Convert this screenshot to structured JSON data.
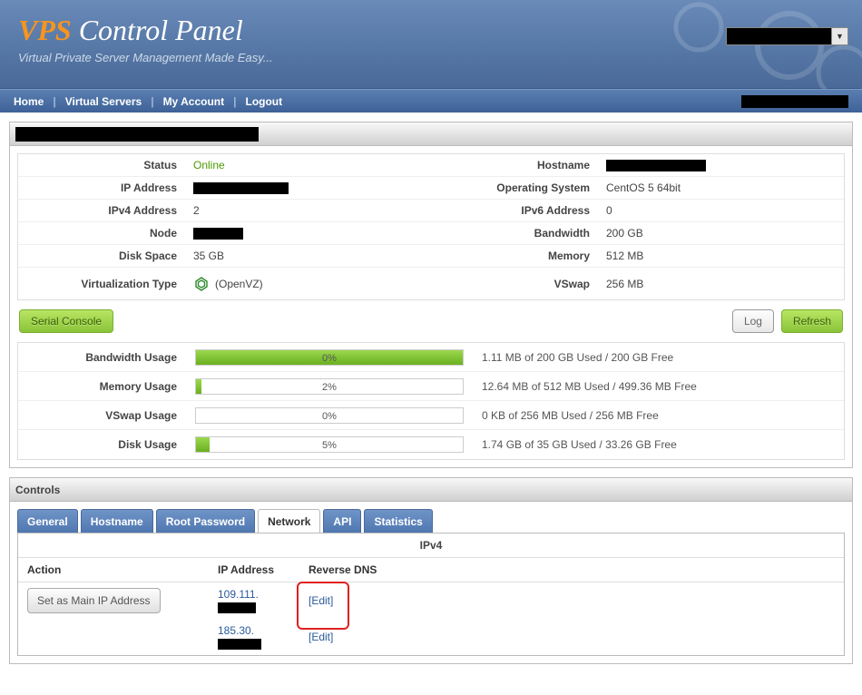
{
  "header": {
    "logo_prefix": "VPS",
    "logo_suffix": " Control Panel",
    "tagline": "Virtual Private Server Management Made Easy..."
  },
  "nav": {
    "home": "Home",
    "virtual_servers": "Virtual Servers",
    "my_account": "My Account",
    "logout": "Logout"
  },
  "info_left": {
    "status_label": "Status",
    "status_value": "Online",
    "ip_label": "IP Address",
    "ipv4_label": "IPv4 Address",
    "ipv4_value": "2",
    "node_label": "Node",
    "disk_label": "Disk Space",
    "disk_value": "35 GB",
    "virt_label": "Virtualization Type",
    "virt_value": "(OpenVZ)"
  },
  "info_right": {
    "hostname_label": "Hostname",
    "os_label": "Operating System",
    "os_value": "CentOS 5 64bit",
    "ipv6_label": "IPv6 Address",
    "ipv6_value": "0",
    "bw_label": "Bandwidth",
    "bw_value": "200 GB",
    "mem_label": "Memory",
    "mem_value": "512 MB",
    "vswap_label": "VSwap",
    "vswap_value": "256 MB"
  },
  "buttons": {
    "serial_console": "Serial Console",
    "log": "Log",
    "refresh": "Refresh"
  },
  "usage": {
    "bw_label": "Bandwidth Usage",
    "bw_pct": "0%",
    "bw_width": "0%",
    "bw_text": "1.11 MB of 200 GB Used / 200 GB Free",
    "mem_label": "Memory Usage",
    "mem_pct": "2%",
    "mem_width": "2%",
    "mem_text": "12.64 MB of 512 MB Used / 499.36 MB Free",
    "vs_label": "VSwap Usage",
    "vs_pct": "0%",
    "vs_width": "0%",
    "vs_text": "0 KB of 256 MB Used / 256 MB Free",
    "disk_label": "Disk Usage",
    "disk_pct": "5%",
    "disk_width": "5%",
    "disk_text": "1.74 GB of 35 GB Used / 33.26 GB Free"
  },
  "controls": {
    "title": "Controls",
    "tabs": {
      "general": "General",
      "hostname": "Hostname",
      "root_password": "Root Password",
      "network": "Network",
      "api": "API",
      "statistics": "Statistics"
    },
    "ipv4_header": "IPv4",
    "col_action": "Action",
    "col_ip": "IP Address",
    "col_rdns": "Reverse DNS",
    "set_main": "Set as Main IP Address",
    "ip1_prefix": "109.111.",
    "ip2_prefix": "185.30.",
    "edit": "[Edit]"
  }
}
